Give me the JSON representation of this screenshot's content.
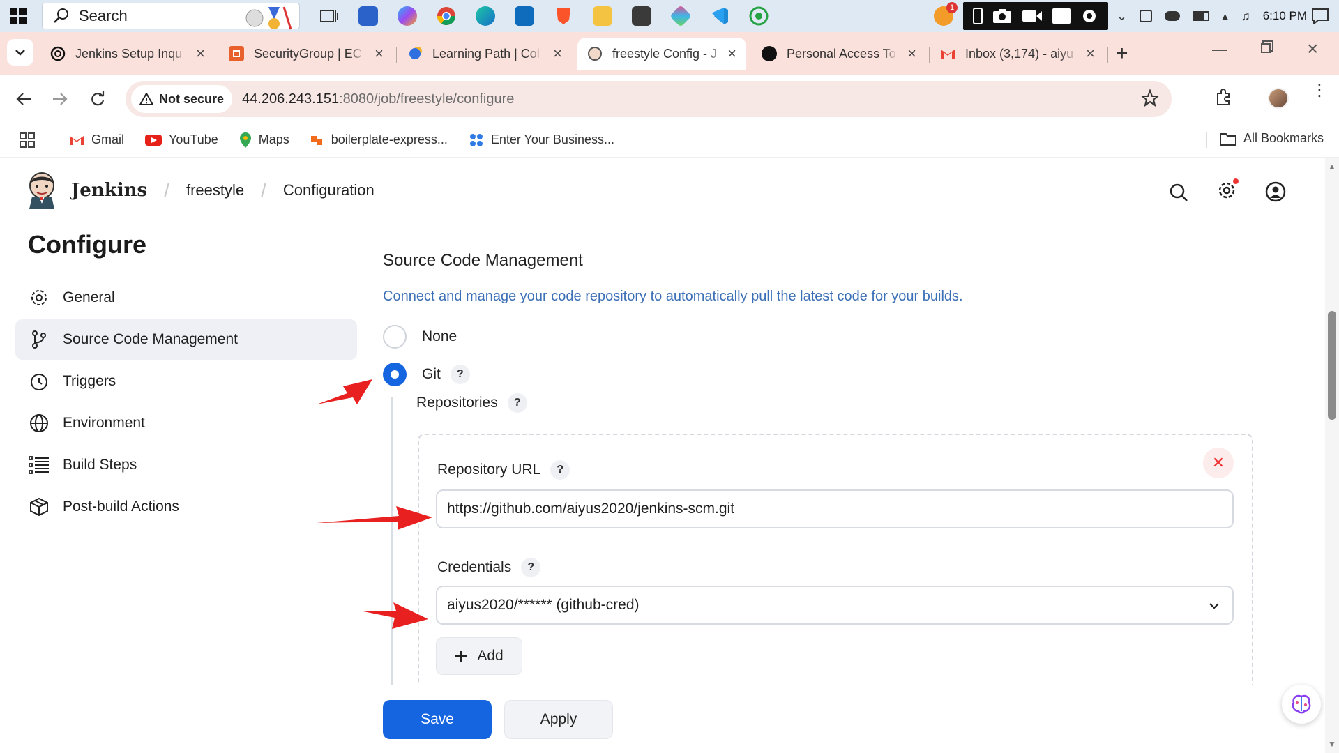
{
  "taskbar": {
    "search_placeholder": "Search",
    "time": "6:10 PM",
    "notification_count": "1"
  },
  "tabs": [
    {
      "title": "Jenkins Setup Inqu",
      "favicon": "openai-icon"
    },
    {
      "title": "SecurityGroup | EC",
      "favicon": "aws-icon"
    },
    {
      "title": "Learning Path | Col",
      "favicon": "learning-icon"
    },
    {
      "title": "freestyle Config - J",
      "favicon": "jenkins-icon",
      "active": true
    },
    {
      "title": "Personal Access To",
      "favicon": "github-icon"
    },
    {
      "title": "Inbox (3,174) - aiyu",
      "favicon": "gmail-icon"
    }
  ],
  "address": {
    "security_label": "Not secure",
    "host": "44.206.243.151",
    "path": ":8080/job/freestyle/configure"
  },
  "bookmarks": {
    "items": [
      "Gmail",
      "YouTube",
      "Maps",
      "boilerplate-express...",
      "Enter Your Business..."
    ],
    "all_label": "All Bookmarks"
  },
  "header": {
    "brand": "Jenkins",
    "crumbs": [
      "freestyle",
      "Configuration"
    ]
  },
  "sidebar": {
    "title": "Configure",
    "items": [
      {
        "label": "General",
        "icon": "gear-icon"
      },
      {
        "label": "Source Code Management",
        "icon": "branch-icon",
        "active": true
      },
      {
        "label": "Triggers",
        "icon": "clock-icon"
      },
      {
        "label": "Environment",
        "icon": "globe-icon"
      },
      {
        "label": "Build Steps",
        "icon": "list-icon"
      },
      {
        "label": "Post-build Actions",
        "icon": "package-icon"
      }
    ]
  },
  "scm": {
    "title": "Source Code Management",
    "description": "Connect and manage your code repository to automatically pull the latest code for your builds.",
    "options": [
      "None",
      "Git"
    ],
    "selected": "Git",
    "help_mark": "?",
    "repositories_label": "Repositories",
    "repo_url_label": "Repository URL",
    "repo_url_value": "https://github.com/aiyus2020/jenkins-scm.git",
    "credentials_label": "Credentials",
    "credentials_value": "aiyus2020/****** (github-cred)",
    "add_label": "Add"
  },
  "actions": {
    "save": "Save",
    "apply": "Apply"
  },
  "colors": {
    "primary": "#1665e0",
    "link_text": "#3b6fb6",
    "tabstrip": "#fbe1dc",
    "annotation_arrow": "#e82020"
  }
}
